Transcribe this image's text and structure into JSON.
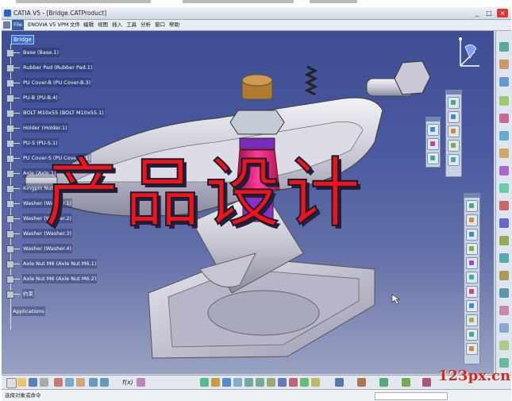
{
  "window": {
    "title": "CATIA V5 - [Bridge.CATProduct]",
    "controls": [
      "_",
      "□",
      "×"
    ]
  },
  "menu": {
    "items": [
      "File",
      "ENOVIA V5 VPM",
      "文件",
      "编辑",
      "视图",
      "插入",
      "工具",
      "分析",
      "窗口",
      "帮助"
    ]
  },
  "tree": {
    "root": "Bridge",
    "nodes": [
      "Base (Base.1)",
      "Rubber Pad (Rubber Pad.1)",
      "PU Cover-B (PU Cover-B.3)",
      "PU-B (PU-B.4)",
      "BOLT M10x55 (BOLT M10x55.1)",
      "Holder (Holder.1)",
      "PU-S (PU-S.1)",
      "PU Cover-S (PU Cover-S.1)",
      "Axle (Axle.1)",
      "Kingpin Nut (Kingpin Nut.1)",
      "Washer (Washer.1)",
      "Washer (Washer.2)",
      "Washer (Washer.3)",
      "Washer (Washer.4)",
      "Axle Nut M6 (Axle Nut M6.1)",
      "Axle Nut M6 (Axle Nut M6.2)",
      "约束"
    ],
    "applications": "Applications"
  },
  "overlay": {
    "text": "产品设计"
  },
  "status": {
    "text": "选择对象或命令"
  },
  "watermark": {
    "text": "123px.cn"
  },
  "icons": {
    "compass": "compass-icon",
    "toolbar_fx": "f(x)"
  },
  "colors": {
    "viewport_top": "#3f4d92",
    "viewport_bottom": "#9aa2c2",
    "overlay_red": "#f01418",
    "tree_highlight": "#3b6fd8",
    "watermark_red": "#d8241a"
  }
}
